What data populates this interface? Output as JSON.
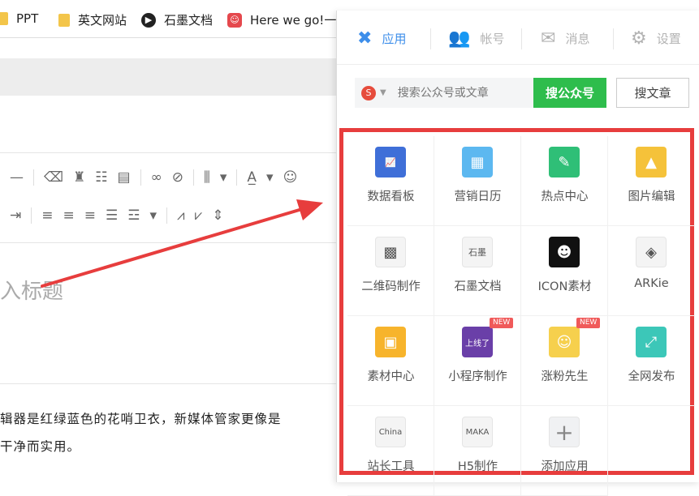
{
  "bookmarks": [
    {
      "label": "PPT",
      "icon": "folder-icon"
    },
    {
      "label": "英文网站",
      "icon": "folder-icon"
    },
    {
      "label": "石墨文档",
      "icon": "shimo-icon"
    },
    {
      "label": "Here we go!一小",
      "icon": "app-red-icon"
    }
  ],
  "editor": {
    "title_placeholder": "入标题",
    "body_line_1": "辑器是红绿蓝色的花哨卫衣，新媒体管家更像是",
    "body_line_2": "干净而实用。"
  },
  "popup": {
    "tabs": [
      {
        "label": "应用",
        "icon": "apps-icon",
        "active": true
      },
      {
        "label": "帐号",
        "icon": "account-icon",
        "active": false
      },
      {
        "label": "消息",
        "icon": "message-icon",
        "active": false
      },
      {
        "label": "设置",
        "icon": "gear-icon",
        "active": false
      }
    ],
    "search": {
      "engine_icon": "sogou-icon",
      "placeholder": "搜索公众号或文章",
      "btn_accounts": "搜公众号",
      "btn_articles": "搜文章"
    },
    "apps": [
      {
        "label": "数据看板",
        "icon": "chart-icon",
        "color": "#3f6fd8"
      },
      {
        "label": "营销日历",
        "icon": "calendar-icon",
        "color": "#5cb8f0"
      },
      {
        "label": "热点中心",
        "icon": "pen-icon",
        "color": "#2fbf77"
      },
      {
        "label": "图片编辑",
        "icon": "image-edit-icon",
        "color": "#f5c23a"
      },
      {
        "label": "二维码制作",
        "icon": "qrcode-icon",
        "color": "#f4f4f4"
      },
      {
        "label": "石墨文档",
        "icon": "shimo-doc-icon",
        "color": "#f4f4f4"
      },
      {
        "label": "ICON素材",
        "icon": "icon-material-icon",
        "color": "#111111"
      },
      {
        "label": "ARKie",
        "icon": "arkie-icon",
        "color": "#f4f4f4"
      },
      {
        "label": "素材中心",
        "icon": "material-icon",
        "color": "#f7b42c"
      },
      {
        "label": "小程序制作",
        "icon": "miniprogram-icon",
        "color": "#6a3fa8",
        "badge": "NEW"
      },
      {
        "label": "涨粉先生",
        "icon": "mascot-icon",
        "color": "#f6d04d",
        "badge": "NEW"
      },
      {
        "label": "全网发布",
        "icon": "publish-icon",
        "color": "#3cc7b8"
      },
      {
        "label": "站长工具",
        "icon": "chinaz-icon",
        "color": "#f4f4f4"
      },
      {
        "label": "H5制作",
        "icon": "maka-icon",
        "color": "#f4f4f4"
      },
      {
        "label": "添加应用",
        "icon": "plus-icon",
        "color": "#f0f1f3"
      }
    ]
  },
  "annotation": {
    "highlight_color": "#e73d3d"
  }
}
